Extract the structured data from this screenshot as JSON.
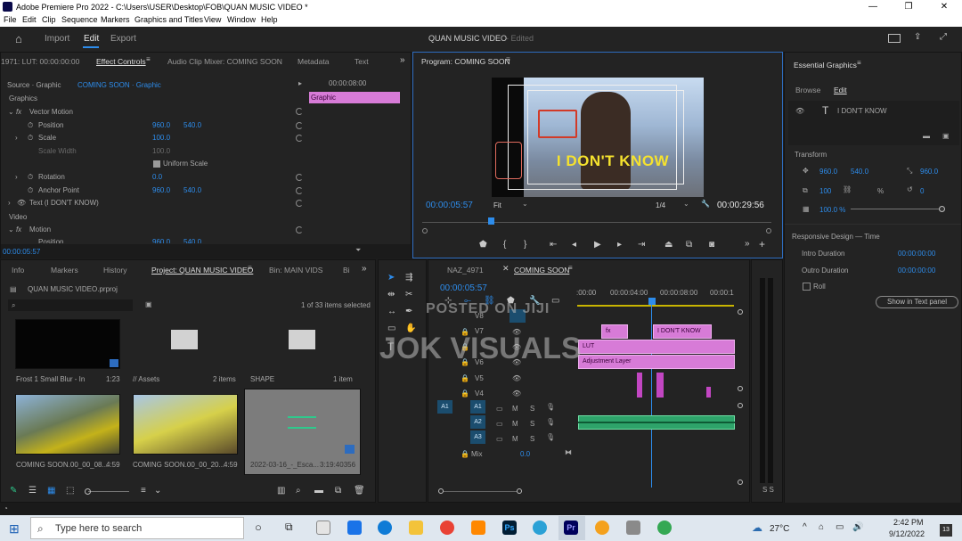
{
  "window": {
    "title": "Adobe Premiere Pro 2022 - C:\\Users\\USER\\Desktop\\FOB\\QUAN MUSIC VIDEO *"
  },
  "menu": [
    "File",
    "Edit",
    "Clip",
    "Sequence",
    "Markers",
    "Graphics and Titles",
    "View",
    "Window",
    "Help"
  ],
  "workspace": {
    "tabs": [
      "Import",
      "Edit",
      "Export"
    ],
    "active": "Edit",
    "project_title": "QUAN MUSIC VIDEO",
    "project_status": "- Edited"
  },
  "effect_controls": {
    "tabs": [
      "1971: LUT: 00:00:00:00",
      "Effect Controls",
      "Audio Clip Mixer: COMING SOON",
      "Metadata",
      "Text"
    ],
    "source": "Source · Graphic",
    "sequence": "COMING SOON · Graphic",
    "timecode_top": "00:00:08:00",
    "clip_label": "Graphic",
    "section_graphics": "Graphics",
    "vector_motion": "Vector Motion",
    "props": [
      {
        "name": "Position",
        "v1": "960.0",
        "v2": "540.0"
      },
      {
        "name": "Scale",
        "v1": "100.0",
        "v2": ""
      },
      {
        "name": "Scale Width",
        "v1": "100.0",
        "v2": ""
      },
      {
        "name": "Uniform Scale",
        "v1": "",
        "v2": ""
      },
      {
        "name": "Rotation",
        "v1": "0.0",
        "v2": ""
      },
      {
        "name": "Anchor Point",
        "v1": "960.0",
        "v2": "540.0"
      }
    ],
    "text_layer": "Text (I DON'T KNOW)",
    "section_video": "Video",
    "motion": "Motion",
    "motion_position": {
      "name": "Position",
      "v1": "960.0",
      "v2": "540.0"
    },
    "timecode": "00:00:05:57"
  },
  "program": {
    "tab": "Program: COMING SOON",
    "overlay_text": "I DON'T KNOW",
    "timecode": "00:00:05:57",
    "fit": "Fit",
    "fraction": "1/4",
    "duration": "00:00:29:56"
  },
  "essential_graphics": {
    "tab": "Essential Graphics",
    "subtabs": [
      "Browse",
      "Edit"
    ],
    "layer": "I DON'T KNOW",
    "transform": "Transform",
    "pos_x": "960.0",
    "pos_y": "540.0",
    "anchor": "960.0",
    "scale": "100",
    "pct": "%",
    "rot": "0",
    "opacity": "100.0 %",
    "responsive": "Responsive Design — Time",
    "intro": "Intro Duration",
    "intro_val": "00:00:00:00",
    "outro": "Outro Duration",
    "outro_val": "00:00:00:00",
    "roll": "Roll",
    "show_btn": "Show in Text panel"
  },
  "project": {
    "tabs": [
      "Info",
      "Markers",
      "History",
      "Project: QUAN MUSIC VIDEO",
      "Bin: MAIN VIDS",
      "Bi"
    ],
    "file": "QUAN MUSIC VIDEO.prproj",
    "selected": "1 of 33 items selected",
    "items": [
      {
        "name": "Frost 1 Small Blur - In",
        "meta": "1:23"
      },
      {
        "name": "// Assets",
        "meta": "2 items"
      },
      {
        "name": "SHAPE",
        "meta": "1 item"
      },
      {
        "name": "COMING SOON.00_00_08...",
        "meta": "4:59"
      },
      {
        "name": "COMING SOON.00_00_20...",
        "meta": "4:59"
      },
      {
        "name": "2022-03-16_-_Esca...",
        "meta": "3:19:40356"
      }
    ]
  },
  "timeline": {
    "tabs": [
      "NAZ_4971",
      "COMING SOON"
    ],
    "timecode": "00:00:05:57",
    "ruler": [
      ":00:00",
      "00:00:04:00",
      "00:00:08:00",
      "00:00:1"
    ],
    "video_tracks": [
      "V8",
      "V7",
      "V6",
      "V5",
      "V4"
    ],
    "audio_tracks": [
      "A1",
      "A2",
      "A3"
    ],
    "source_patch": "A1",
    "mix": "Mix",
    "mix_val": "0.0",
    "clips": {
      "text": "I DON'T KNOW",
      "lut": "LUT",
      "adj": "Adjustment Layer",
      "fx": "fx"
    },
    "meter": "S  S"
  },
  "watermarks": {
    "line1": "POSTED ON JIJI",
    "line2": "JOK VISUALS"
  },
  "taskbar": {
    "search": "Type here to search",
    "temp": "27°C",
    "time": "2:42 PM",
    "date": "9/12/2022",
    "badge": "13"
  }
}
